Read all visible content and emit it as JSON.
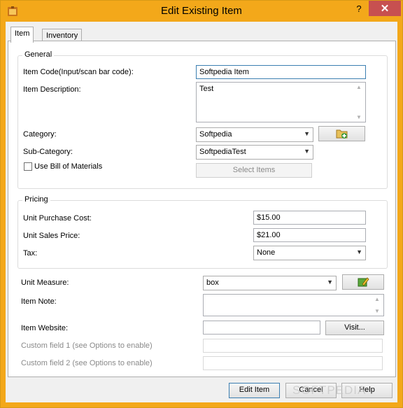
{
  "window": {
    "title": "Edit Existing Item",
    "help_glyph": "?",
    "close_glyph": "✕"
  },
  "tabs": [
    {
      "label": "Item"
    },
    {
      "label": "Inventory"
    }
  ],
  "general": {
    "legend": "General",
    "item_code_label": "Item Code(Input/scan bar code):",
    "item_code_value": "Softpedia Item",
    "item_description_label": "Item Description:",
    "item_description_value": "Test",
    "category_label": "Category:",
    "category_value": "Softpedia",
    "subcategory_label": "Sub-Category:",
    "subcategory_value": "SoftpediaTest",
    "bill_of_materials_label": "Use Bill of Materials",
    "select_items_label": "Select Items"
  },
  "pricing": {
    "legend": "Pricing",
    "unit_purchase_cost_label": "Unit Purchase Cost:",
    "unit_purchase_cost_value": "$15.00",
    "unit_sales_price_label": "Unit Sales Price:",
    "unit_sales_price_value": "$21.00",
    "tax_label": "Tax:",
    "tax_value": "None"
  },
  "other": {
    "unit_measure_label": "Unit Measure:",
    "unit_measure_value": "box",
    "item_note_label": "Item Note:",
    "item_note_value": "",
    "item_website_label": "Item Website:",
    "item_website_value": "",
    "visit_button_label": "Visit...",
    "custom_field_1_label": "Custom field 1 (see Options to enable)",
    "custom_field_2_label": "Custom field 2 (see Options to enable)"
  },
  "footer": {
    "edit_item_label": "Edit Item",
    "cancel_label": "Cancel",
    "help_label": "Help"
  },
  "watermark": "SOFTPEDIA",
  "icons": {
    "category_button": "folder-add-icon",
    "unit_measure_button": "edit-pencil-icon"
  },
  "colors": {
    "titlebar": "#f3a81a",
    "close_button": "#c75050",
    "focus_border": "#3c7fb1"
  }
}
